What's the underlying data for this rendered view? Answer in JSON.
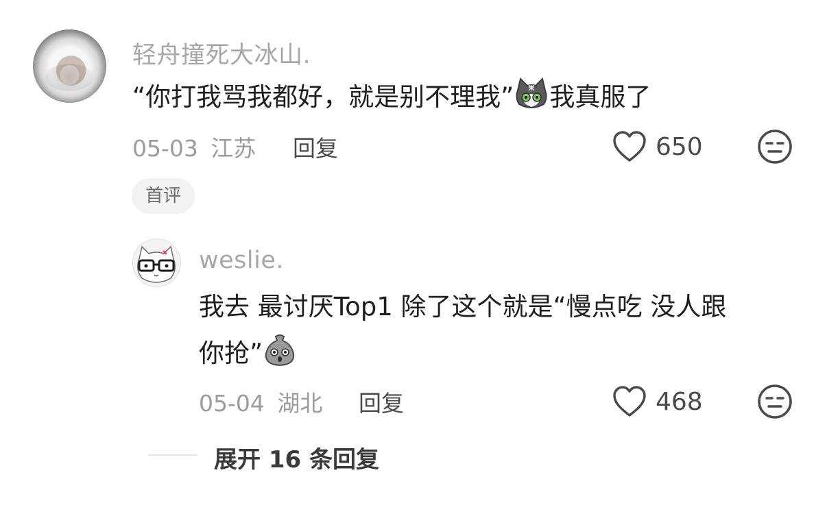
{
  "comment": {
    "username": "轻舟撞死大冰山.",
    "text_before_emoji": "“你打我骂我都好，就是别不理我”",
    "text_after_emoji": "我真服了",
    "emoji_icon": "cat-face-emoji",
    "date": "05-03",
    "location": "江苏",
    "reply_label": "回复",
    "likes": "650",
    "tag": "首评"
  },
  "reply": {
    "username": "weslie.",
    "text_line1": "我去 最讨厌Top1 除了这个就是“慢点吃 没人跟",
    "text_line2": "你抢”",
    "emoji_icon": "bag-face-emoji",
    "date": "05-04",
    "location": "湖北",
    "reply_label": "回复",
    "likes": "468"
  },
  "expand_label": "展开 16 条回复",
  "icons": {
    "like": "heart-outline-icon",
    "dislike": "meh-face-icon"
  }
}
